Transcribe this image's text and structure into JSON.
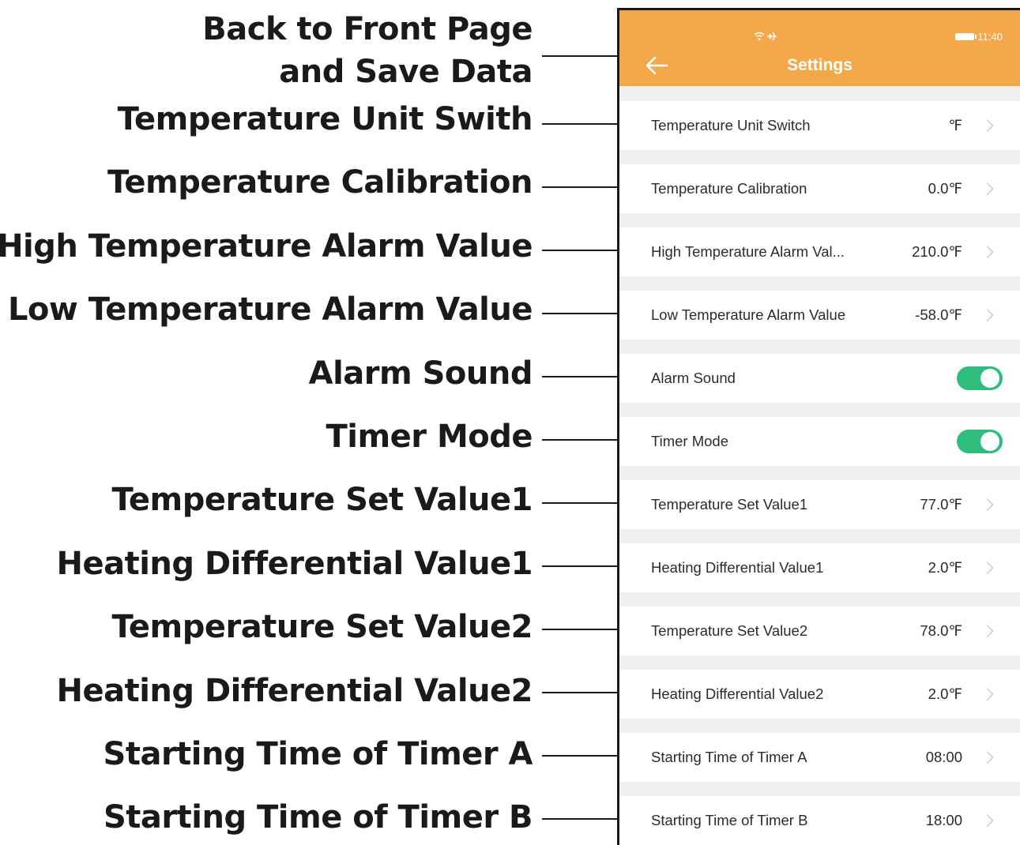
{
  "callouts": [
    "Back to Front Page\nand Save Data",
    "Temperature Unit Swith",
    "Temperature Calibration",
    "High Temperature Alarm Value",
    "Low Temperature Alarm Value",
    "Alarm Sound",
    "Timer Mode",
    "Temperature Set Value1",
    "Heating Differential Value1",
    "Temperature Set Value2",
    "Heating Differential Value2",
    "Starting Time of Timer A",
    "Starting Time of Timer B"
  ],
  "status_bar": {
    "icons": "wifi-airplane-icons",
    "time": "11:40"
  },
  "header": {
    "title": "Settings",
    "back_icon": "arrow-left-icon"
  },
  "settings": [
    {
      "label": "Temperature Unit Switch",
      "value": "℉",
      "type": "value"
    },
    {
      "label": "Temperature Calibration",
      "value": "0.0℉",
      "type": "value"
    },
    {
      "label": "High Temperature Alarm Val...",
      "value": "210.0℉",
      "type": "value"
    },
    {
      "label": "Low Temperature Alarm Value",
      "value": "-58.0℉",
      "type": "value"
    },
    {
      "label": "Alarm Sound",
      "value": "on",
      "type": "toggle"
    },
    {
      "label": "Timer Mode",
      "value": "on",
      "type": "toggle"
    },
    {
      "label": "Temperature Set Value1",
      "value": "77.0℉",
      "type": "value"
    },
    {
      "label": "Heating Differential Value1",
      "value": "2.0℉",
      "type": "value"
    },
    {
      "label": "Temperature Set Value2",
      "value": "78.0℉",
      "type": "value"
    },
    {
      "label": "Heating Differential Value2",
      "value": "2.0℉",
      "type": "value"
    },
    {
      "label": "Starting Time of Timer A",
      "value": "08:00",
      "type": "value"
    },
    {
      "label": "Starting Time of Timer B",
      "value": "18:00",
      "type": "value"
    }
  ],
  "colors": {
    "header": "#f3a94a",
    "toggle_on": "#2ebd7d",
    "list_background": "#efefef"
  }
}
